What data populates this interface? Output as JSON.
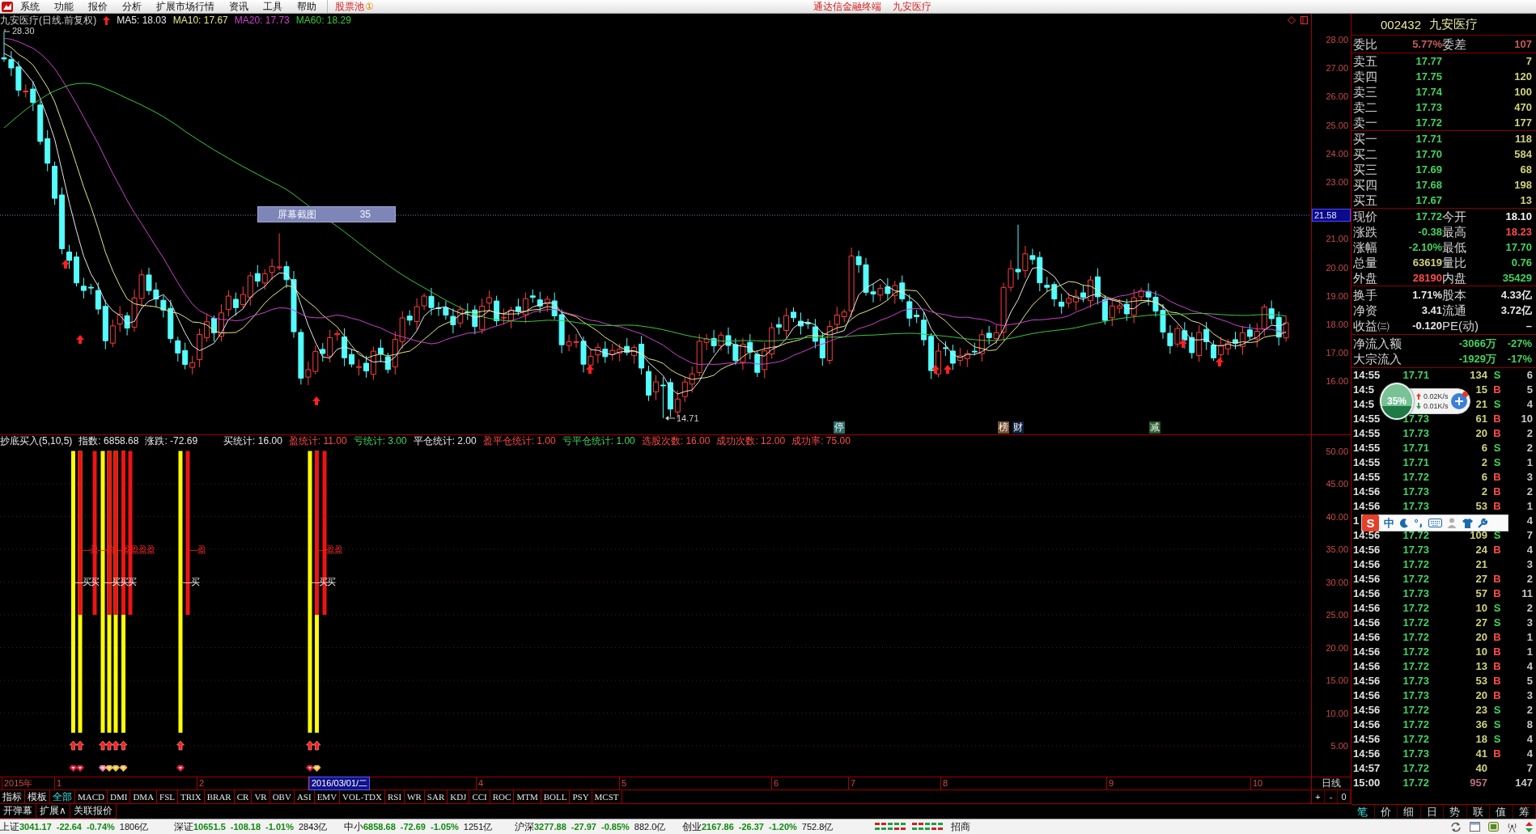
{
  "menu_bar": {
    "items": [
      "系统",
      "功能",
      "报价",
      "分析",
      "扩展市场行情",
      "资讯",
      "工具",
      "帮助"
    ],
    "stock_pool": {
      "label": "股票池",
      "badge": "①"
    },
    "app_name": "通达信金融终端",
    "stock_name": "九安医疗"
  },
  "chart": {
    "title": "九安医疗(日线.前复权)",
    "moving_averages": [
      {
        "label": "MA5: 18.03",
        "color": "#e8e8e8"
      },
      {
        "label": "MA10: 17.67",
        "color": "#e6e68a"
      },
      {
        "label": "MA20: 17.73",
        "color": "#d040d0"
      },
      {
        "label": "MA60: 18.29",
        "color": "#3cc83c"
      }
    ],
    "high_label": "28.30",
    "low_label": "14.71",
    "event_marks": [
      {
        "text": "停",
        "color": "#2d6b6b"
      },
      {
        "text": "榜",
        "color": "#7a5030"
      },
      {
        "text": "财",
        "color": "#102040"
      },
      {
        "text": "减",
        "color": "#2a5a2a"
      }
    ],
    "price_ticks": [
      "28.00",
      "27.00",
      "26.00",
      "25.00",
      "24.00",
      "23.00",
      "21.00",
      "20.00",
      "19.00",
      "18.00",
      "17.00",
      "16.00"
    ],
    "cursor_price": "21.58",
    "screenshot_hint": {
      "label": "屏幕截图",
      "value": "35"
    }
  },
  "indicator": {
    "title": "抄底买入(5,10,5)",
    "index_stats": [
      {
        "text": "指数: 6858.68",
        "color": "#e8e8e8"
      },
      {
        "text": "涨跌: -72.69",
        "color": "#e8e8e8"
      }
    ],
    "signal_stats": [
      {
        "text": "买统计: 16.00",
        "color": "#e8e8e8"
      },
      {
        "text": "盈统计: 11.00",
        "color": "#ff4b4b"
      },
      {
        "text": "亏统计: 3.00",
        "color": "#43d35e"
      },
      {
        "text": "平仓统计: 2.00",
        "color": "#e8e8e8"
      },
      {
        "text": "盈平仓统计: 1.00",
        "color": "#ff4b4b"
      },
      {
        "text": "亏平仓统计: 1.00",
        "color": "#43d35e"
      },
      {
        "text": "选股次数: 16.00",
        "color": "#ff4b4b"
      },
      {
        "text": "成功次数: 12.00",
        "color": "#ff4b4b"
      },
      {
        "text": "成功率: 75.00",
        "color": "#ff4b4b"
      }
    ],
    "ticks": [
      "50.00",
      "45.00",
      "40.00",
      "35.00",
      "30.00",
      "25.00",
      "20.00",
      "15.00",
      "10.00",
      "5.00"
    ],
    "buy_labels": [
      "—买买",
      "—买买买",
      "—买",
      "—买买"
    ],
    "profit_labels": [
      "—盈—盈",
      "—盈盈盈盈",
      "—盈",
      "—盈盈"
    ]
  },
  "date_axis": {
    "labels": [
      {
        "text": "2015年",
        "kind": "year"
      },
      {
        "text": "1",
        "kind": "month"
      },
      {
        "text": "2",
        "kind": "month"
      },
      {
        "text": "2016/03/01/二",
        "kind": "cursor"
      },
      {
        "text": "4",
        "kind": "month"
      },
      {
        "text": "5",
        "kind": "month"
      },
      {
        "text": "6",
        "kind": "month"
      },
      {
        "text": "7",
        "kind": "month"
      },
      {
        "text": "8",
        "kind": "month"
      },
      {
        "text": "9",
        "kind": "month"
      },
      {
        "text": "10",
        "kind": "month"
      }
    ],
    "period": "日线"
  },
  "indicator_tabs": [
    {
      "label": "指标",
      "selected": false
    },
    {
      "label": "模板",
      "selected": false
    },
    {
      "label": "全部",
      "selected": true
    },
    {
      "label": "MACD",
      "selected": false
    },
    {
      "label": "DMI",
      "selected": false
    },
    {
      "label": "DMA",
      "selected": false
    },
    {
      "label": "FSL",
      "selected": false
    },
    {
      "label": "TRIX",
      "selected": false
    },
    {
      "label": "BRAR",
      "selected": false
    },
    {
      "label": "CR",
      "selected": false
    },
    {
      "label": "VR",
      "selected": false
    },
    {
      "label": "OBV",
      "selected": false
    },
    {
      "label": "ASI",
      "selected": false
    },
    {
      "label": "EMV",
      "selected": false
    },
    {
      "label": "VOL-TDX",
      "selected": false
    },
    {
      "label": "RSI",
      "selected": false
    },
    {
      "label": "WR",
      "selected": false
    },
    {
      "label": "SAR",
      "selected": false
    },
    {
      "label": "KDJ",
      "selected": false
    },
    {
      "label": "CCI",
      "selected": false
    },
    {
      "label": "ROC",
      "selected": false
    },
    {
      "label": "MTM",
      "selected": false
    },
    {
      "label": "BOLL",
      "selected": false
    },
    {
      "label": "PSY",
      "selected": false
    },
    {
      "label": "MCST",
      "selected": false
    }
  ],
  "zoom_controls": [
    "+",
    "-",
    "0"
  ],
  "options": [
    "开弹幕",
    "扩展∧",
    "关联报价"
  ],
  "quote": {
    "code": "002432",
    "name": "九安医疗",
    "ratio": [
      {
        "label": "委比",
        "value": "5.77%"
      },
      {
        "label": "委差",
        "value": "107"
      }
    ],
    "asks": [
      {
        "label": "卖五",
        "price": "17.77",
        "volume": "7",
        "color": "#43d35e"
      },
      {
        "label": "卖四",
        "price": "17.75",
        "volume": "120",
        "color": "#43d35e"
      },
      {
        "label": "卖三",
        "price": "17.74",
        "volume": "100",
        "color": "#43d35e"
      },
      {
        "label": "卖二",
        "price": "17.73",
        "volume": "470",
        "color": "#43d35e"
      },
      {
        "label": "卖一",
        "price": "17.72",
        "volume": "177",
        "color": "#43d35e"
      }
    ],
    "bids": [
      {
        "label": "买一",
        "price": "17.71",
        "volume": "118",
        "color": "#43d35e"
      },
      {
        "label": "买二",
        "price": "17.70",
        "volume": "584",
        "color": "#43d35e"
      },
      {
        "label": "买三",
        "price": "17.69",
        "volume": "68",
        "color": "#43d35e"
      },
      {
        "label": "买四",
        "price": "17.68",
        "volume": "198",
        "color": "#43d35e"
      },
      {
        "label": "买五",
        "price": "17.67",
        "volume": "13",
        "color": "#43d35e"
      }
    ],
    "stats": [
      [
        {
          "label": "现价",
          "value": "17.72",
          "color": "#43d35e"
        },
        {
          "label": "今开",
          "value": "18.10",
          "color": "#f4f4f4"
        }
      ],
      [
        {
          "label": "涨跌",
          "value": "-0.38",
          "color": "#43d35e"
        },
        {
          "label": "最高",
          "value": "18.23",
          "color": "#ff4b4b"
        }
      ],
      [
        {
          "label": "涨幅",
          "value": "-2.10%",
          "color": "#43d35e"
        },
        {
          "label": "最低",
          "value": "17.70",
          "color": "#43d35e"
        }
      ],
      [
        {
          "label": "总量",
          "value": "63619",
          "color": "#d2d27e"
        },
        {
          "label": "量比",
          "value": "0.76",
          "color": "#43d35e"
        }
      ],
      [
        {
          "label": "外盘",
          "value": "28190",
          "color": "#ff4b4b"
        },
        {
          "label": "内盘",
          "value": "35429",
          "color": "#43d35e"
        }
      ]
    ],
    "extra": [
      [
        {
          "label": "换手",
          "value": "1.71%",
          "color": "#e8e8e8"
        },
        {
          "label": "股本",
          "value": "4.33亿",
          "color": "#e8e8e8"
        }
      ],
      [
        {
          "label": "净资",
          "value": "3.41",
          "color": "#e8e8e8"
        },
        {
          "label": "流通",
          "value": "3.72亿",
          "color": "#e8e8e8"
        }
      ],
      [
        {
          "label": "收益㈢",
          "value": "-0.120",
          "color": "#e8e8e8"
        },
        {
          "label": "PE(动)",
          "value": "–",
          "color": "#e8e8e8"
        }
      ]
    ],
    "flows": [
      {
        "label": "净流入额",
        "amount": "-3066万",
        "percent": "-27%",
        "color": "#43d35e"
      },
      {
        "label": "大宗流入",
        "amount": "-1929万",
        "percent": "-17%",
        "color": "#43d35e"
      }
    ],
    "trades": [
      {
        "time": "14:55",
        "price": "17.71",
        "volume": "134",
        "side": "S",
        "color": "#43d35e",
        "count": "6",
        "kind": "tick"
      },
      {
        "time": "14:5",
        "volume": "15",
        "side": "B",
        "color": "#ff4b4b",
        "count": "5",
        "kind": "tick"
      },
      {
        "time": "14:5",
        "volume": "21",
        "side": "S",
        "color": "#43d35e",
        "count": "4",
        "kind": "tick"
      },
      {
        "time": "14:55",
        "price": "17.73",
        "volume": "61",
        "side": "B",
        "color": "#ff4b4b",
        "count": "10",
        "kind": "tick"
      },
      {
        "time": "14:55",
        "price": "17.73",
        "volume": "20",
        "side": "B",
        "color": "#ff4b4b",
        "count": "2",
        "kind": "tick"
      },
      {
        "time": "14:55",
        "price": "17.71",
        "volume": "6",
        "side": "S",
        "color": "#43d35e",
        "count": "2",
        "kind": "tick"
      },
      {
        "time": "14:55",
        "price": "17.71",
        "volume": "2",
        "side": "S",
        "color": "#43d35e",
        "count": "1",
        "kind": "tick"
      },
      {
        "time": "14:55",
        "price": "17.72",
        "volume": "6",
        "side": "B",
        "color": "#ff4b4b",
        "count": "3",
        "kind": "tick"
      },
      {
        "time": "14:56",
        "price": "17.73",
        "volume": "2",
        "side": "B",
        "color": "#ff4b4b",
        "count": "2",
        "kind": "tick"
      },
      {
        "time": "14:56",
        "price": "17.73",
        "volume": "53",
        "side": "B",
        "color": "#ff4b4b",
        "count": "1",
        "kind": "tick"
      },
      {
        "time": "1",
        "count": "4"
      },
      {
        "time": "14:56",
        "price": "17.72",
        "volume": "109",
        "side": "S",
        "color": "#43d35e",
        "count": "7",
        "kind": "tick"
      },
      {
        "time": "14:56",
        "price": "17.73",
        "volume": "24",
        "side": "B",
        "color": "#ff4b4b",
        "count": "4",
        "kind": "tick"
      },
      {
        "time": "14:56",
        "price": "17.72",
        "volume": "21",
        "count": "3",
        "kind": "tick"
      },
      {
        "time": "14:56",
        "price": "17.72",
        "volume": "27",
        "side": "B",
        "color": "#ff4b4b",
        "count": "2",
        "kind": "tick"
      },
      {
        "time": "14:56",
        "price": "17.73",
        "volume": "57",
        "side": "B",
        "color": "#ff4b4b",
        "count": "11",
        "kind": "tick"
      },
      {
        "time": "14:56",
        "price": "17.72",
        "volume": "10",
        "side": "S",
        "color": "#43d35e",
        "count": "2",
        "kind": "tick"
      },
      {
        "time": "14:56",
        "price": "17.72",
        "volume": "27",
        "side": "S",
        "color": "#43d35e",
        "count": "3",
        "kind": "tick"
      },
      {
        "time": "14:56",
        "price": "17.72",
        "volume": "20",
        "side": "B",
        "color": "#ff4b4b",
        "count": "1",
        "kind": "tick"
      },
      {
        "time": "14:56",
        "price": "17.72",
        "volume": "10",
        "side": "B",
        "color": "#ff4b4b",
        "count": "1",
        "kind": "tick"
      },
      {
        "time": "14:56",
        "price": "17.72",
        "volume": "13",
        "side": "B",
        "color": "#ff4b4b",
        "count": "4",
        "kind": "tick"
      },
      {
        "time": "14:56",
        "price": "17.73",
        "volume": "53",
        "side": "B",
        "color": "#ff4b4b",
        "count": "5",
        "kind": "tick"
      },
      {
        "time": "14:56",
        "price": "17.73",
        "volume": "20",
        "side": "B",
        "color": "#ff4b4b",
        "count": "3",
        "kind": "tick"
      },
      {
        "time": "14:56",
        "price": "17.72",
        "volume": "23",
        "side": "S",
        "color": "#43d35e",
        "count": "2",
        "kind": "tick"
      },
      {
        "time": "14:56",
        "price": "17.72",
        "volume": "36",
        "side": "S",
        "color": "#43d35e",
        "count": "8",
        "kind": "tick"
      },
      {
        "time": "14:56",
        "price": "17.72",
        "volume": "18",
        "side": "S",
        "color": "#43d35e",
        "count": "4",
        "kind": "tick"
      },
      {
        "time": "14:56",
        "price": "17.73",
        "volume": "41",
        "side": "B",
        "color": "#ff4b4b",
        "count": "4",
        "kind": "tick"
      },
      {
        "time": "14:57",
        "price": "17.72",
        "volume": "40",
        "count": "7",
        "kind": "tick"
      },
      {
        "time": "15:00",
        "price": "17.72",
        "volume": "957",
        "count": "147",
        "kind": "close"
      }
    ],
    "tabs": [
      {
        "label": "笔",
        "selected": true
      },
      {
        "label": "价",
        "selected": false
      },
      {
        "label": "细",
        "selected": false
      },
      {
        "label": "日",
        "selected": false
      },
      {
        "label": "势",
        "selected": false
      },
      {
        "label": "联",
        "selected": false
      },
      {
        "label": "值",
        "selected": false
      },
      {
        "label": "筹",
        "selected": false
      }
    ]
  },
  "status_bar": {
    "indices": [
      {
        "name": "上证",
        "value": "3041.17",
        "change": "-22.64",
        "percent": "-0.74%",
        "amount": "1806亿"
      },
      {
        "name": "深证",
        "value": "10651.5",
        "change": "-108.18",
        "percent": "-1.01%",
        "amount": "2843亿"
      },
      {
        "name": "中小",
        "value": "6858.68",
        "change": "-72.69",
        "percent": "-1.05%",
        "amount": "1251亿"
      },
      {
        "name": "沪深",
        "value": "3277.88",
        "change": "-27.97",
        "percent": "-0.85%",
        "amount": "882.0亿"
      },
      {
        "name": "创业",
        "value": "2167.86",
        "change": "-26.37",
        "percent": "-1.20%",
        "amount": "752.8亿"
      }
    ],
    "broker": "招商"
  },
  "overlays": {
    "net_monitor": {
      "level": 0.35,
      "percent": "35%",
      "upload": "0.02K/s",
      "download": "0.01K/s"
    },
    "ime_toolbar": {
      "logo": "S",
      "mode": "中"
    }
  }
}
